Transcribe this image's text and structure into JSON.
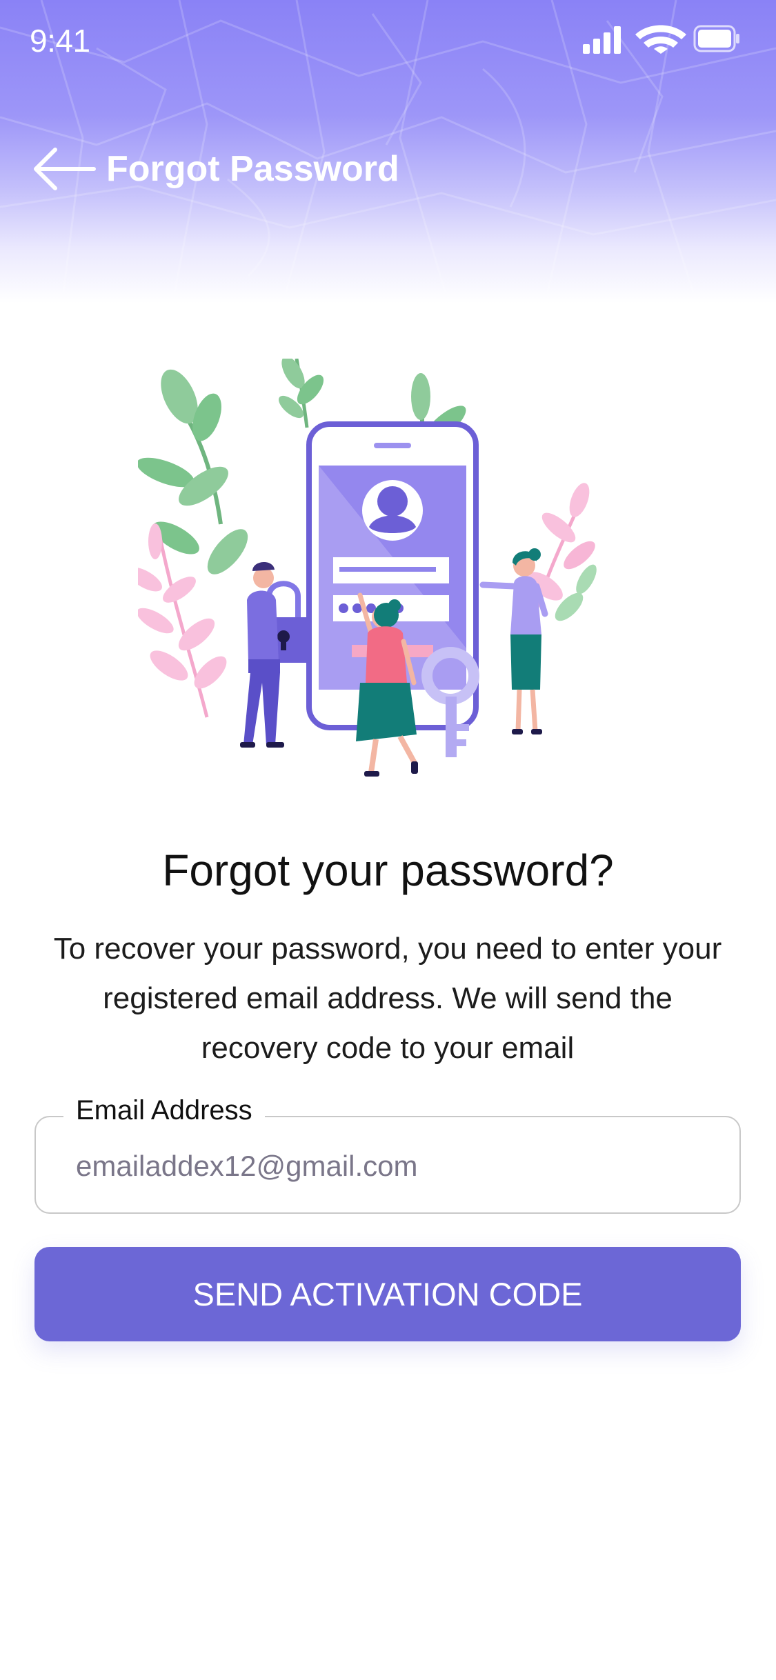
{
  "status_bar": {
    "time": "9:41"
  },
  "header": {
    "title": "Forgot Password",
    "background_colors": [
      "#8a82f6",
      "#c3bffb",
      "#ffffff"
    ]
  },
  "main": {
    "heading": "Forgot your password?",
    "description": "To recover your password, you need to enter your registered email address. We will send the recovery code to your email",
    "email_field": {
      "label": "Email Address",
      "value": "emailaddex12@gmail.com"
    },
    "send_button_label": "SEND ACTIVATION CODE"
  },
  "colors": {
    "accent": "#6c67d6",
    "illustration_purple": "#7b6ee0",
    "illustration_green": "#7cc48c",
    "illustration_pink": "#f7b6d6"
  },
  "icons": {
    "back": "back-arrow-icon",
    "signal": "cellular-signal-icon",
    "wifi": "wifi-icon",
    "battery": "battery-icon"
  }
}
